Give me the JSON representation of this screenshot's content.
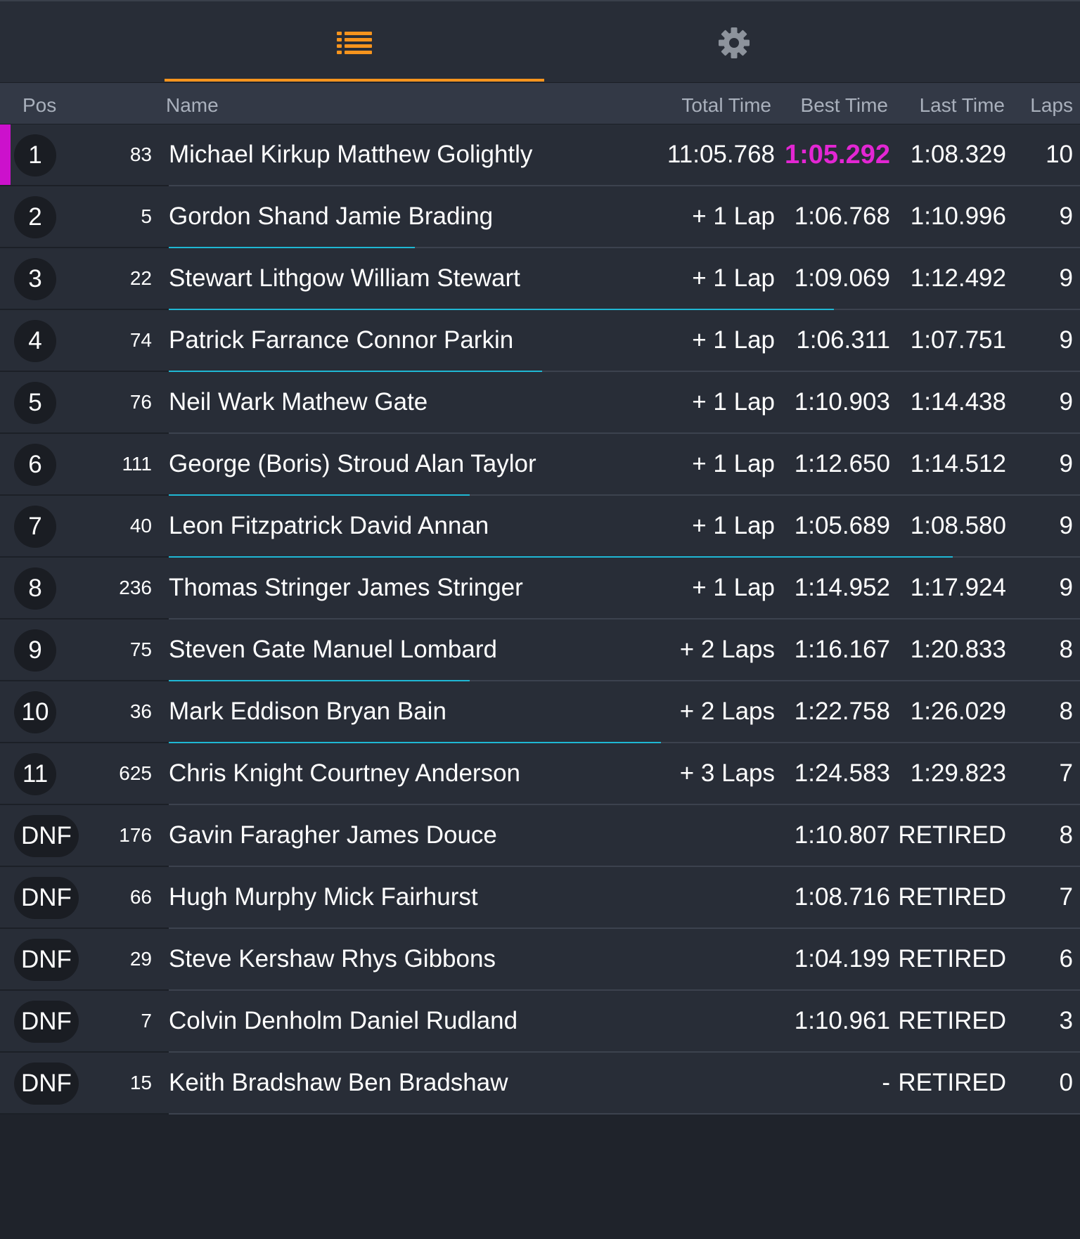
{
  "tabs": [
    {
      "icon": "list-icon",
      "active": true
    },
    {
      "icon": "gear-icon",
      "active": false
    }
  ],
  "colors": {
    "accent": "#f7941d",
    "fastest": "#e326d3",
    "progress": "#1fb7d3",
    "leader_marker": "#cc11cc"
  },
  "header": {
    "pos": "Pos",
    "name": "Name",
    "total": "Total Time",
    "best": "Best Time",
    "last": "Last Time",
    "laps": "Laps"
  },
  "rows": [
    {
      "pos": "1",
      "num": "83",
      "name": "Michael Kirkup Matthew Golightly",
      "total": "11:05.768",
      "best": "1:05.292",
      "last": "1:08.329",
      "laps": "10",
      "fastest": true,
      "leader": true,
      "progress": 0
    },
    {
      "pos": "2",
      "num": "5",
      "name": "Gordon Shand Jamie Brading",
      "total": "+ 1 Lap",
      "best": "1:06.768",
      "last": "1:10.996",
      "laps": "9",
      "progress": 0.27
    },
    {
      "pos": "3",
      "num": "22",
      "name": "Stewart Lithgow William Stewart",
      "total": "+ 1 Lap",
      "best": "1:09.069",
      "last": "1:12.492",
      "laps": "9",
      "progress": 0.73
    },
    {
      "pos": "4",
      "num": "74",
      "name": "Patrick Farrance Connor Parkin",
      "total": "+ 1 Lap",
      "best": "1:06.311",
      "last": "1:07.751",
      "laps": "9",
      "progress": 0.41
    },
    {
      "pos": "5",
      "num": "76",
      "name": "Neil Wark Mathew Gate",
      "total": "+ 1 Lap",
      "best": "1:10.903",
      "last": "1:14.438",
      "laps": "9",
      "progress": 0
    },
    {
      "pos": "6",
      "num": "111",
      "name": "George (Boris) Stroud Alan Taylor",
      "total": "+ 1 Lap",
      "best": "1:12.650",
      "last": "1:14.512",
      "laps": "9",
      "progress": 0.33
    },
    {
      "pos": "7",
      "num": "40",
      "name": "Leon Fitzpatrick David Annan",
      "total": "+ 1 Lap",
      "best": "1:05.689",
      "last": "1:08.580",
      "laps": "9",
      "progress": 0.86
    },
    {
      "pos": "8",
      "num": "236",
      "name": "Thomas Stringer James Stringer",
      "total": "+ 1 Lap",
      "best": "1:14.952",
      "last": "1:17.924",
      "laps": "9",
      "progress": 0
    },
    {
      "pos": "9",
      "num": "75",
      "name": "Steven Gate Manuel Lombard",
      "total": "+ 2 Laps",
      "best": "1:16.167",
      "last": "1:20.833",
      "laps": "8",
      "progress": 0.33
    },
    {
      "pos": "10",
      "num": "36",
      "name": "Mark Eddison Bryan Bain",
      "total": "+ 2 Laps",
      "best": "1:22.758",
      "last": "1:26.029",
      "laps": "8",
      "progress": 0.54
    },
    {
      "pos": "11",
      "num": "625",
      "name": "Chris Knight Courtney Anderson",
      "total": "+ 3 Laps",
      "best": "1:24.583",
      "last": "1:29.823",
      "laps": "7",
      "progress": 0
    },
    {
      "pos": "DNF",
      "num": "176",
      "name": "Gavin Faragher James Douce",
      "total": "",
      "best": "1:10.807",
      "last": "RETIRED",
      "laps": "8",
      "progress": 0
    },
    {
      "pos": "DNF",
      "num": "66",
      "name": "Hugh Murphy Mick Fairhurst",
      "total": "",
      "best": "1:08.716",
      "last": "RETIRED",
      "laps": "7",
      "progress": 0
    },
    {
      "pos": "DNF",
      "num": "29",
      "name": "Steve Kershaw Rhys Gibbons",
      "total": "",
      "best": "1:04.199",
      "last": "RETIRED",
      "laps": "6",
      "progress": 0
    },
    {
      "pos": "DNF",
      "num": "7",
      "name": "Colvin Denholm Daniel Rudland",
      "total": "",
      "best": "1:10.961",
      "last": "RETIRED",
      "laps": "3",
      "progress": 0
    },
    {
      "pos": "DNF",
      "num": "15",
      "name": "Keith Bradshaw Ben Bradshaw",
      "total": "",
      "best": "-",
      "last": "RETIRED",
      "laps": "0",
      "progress": 0
    }
  ]
}
